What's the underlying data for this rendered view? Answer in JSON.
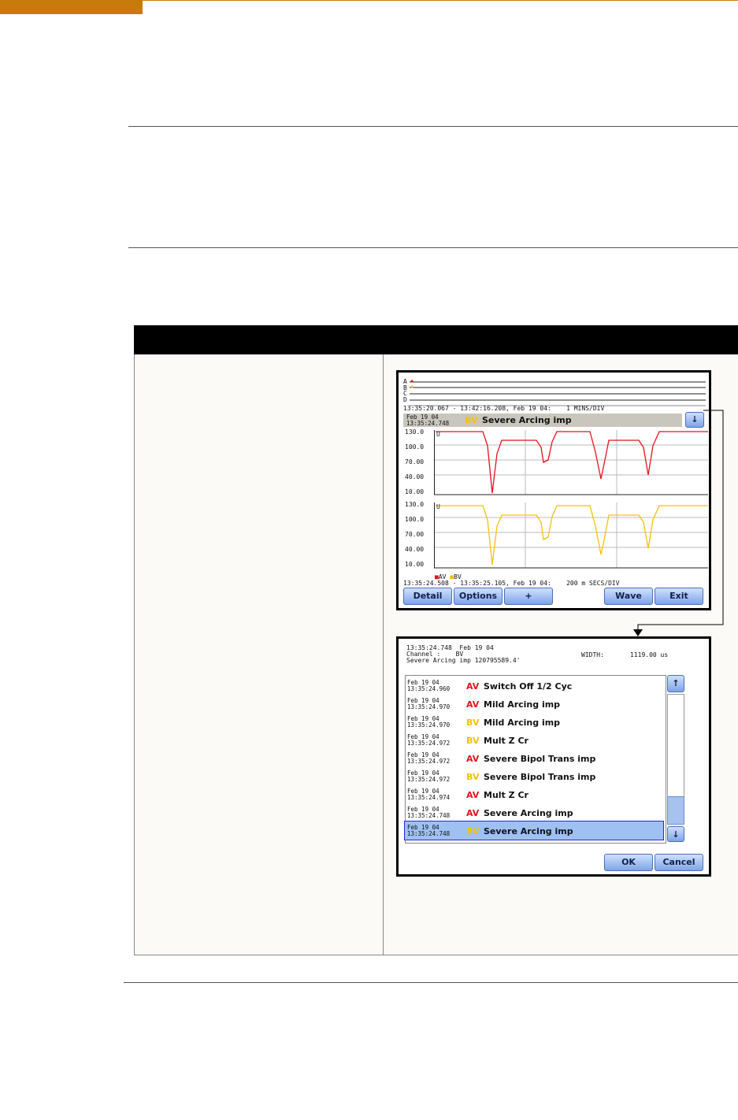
{
  "screen1": {
    "channels": [
      "A",
      "B",
      "C",
      "D"
    ],
    "overview_range": "13:35:20.067 - 13:42:16.208, Feb 19 04:    1 MINS/DIV",
    "event_date": "Feb 19 04",
    "event_time": "13:35:24.748",
    "event_channel": "BV",
    "event_name": "Severe Arcing imp",
    "yticks": [
      "130.0",
      "100.0",
      "70.00",
      "40.00",
      "10.00"
    ],
    "unit_label": "U",
    "legend": [
      {
        "name": "AV",
        "color": "#e8101a"
      },
      {
        "name": "BV",
        "color": "#f5c10a"
      }
    ],
    "detail_range": "13:35:24.508 - 13:35:25.105, Feb 19 04:    200 m SECS/DIV",
    "buttons": {
      "detail": "Detail",
      "options": "Options",
      "plus": "+",
      "wave": "Wave",
      "exit": "Exit"
    }
  },
  "screen2": {
    "header_line1": "13:35:24.748  Feb 19 04",
    "header_line2": "Channel :    BV",
    "header_line3": "Severe Arcing imp 120795589.4'",
    "width_label": "WIDTH:",
    "width_value": "1119.00 us",
    "events": [
      {
        "date": "Feb 19 04",
        "time": "13:35:24.960",
        "channel": "AV",
        "name": "Switch Off 1/2 Cyc"
      },
      {
        "date": "Feb 19 04",
        "time": "13:35:24.970",
        "channel": "AV",
        "name": "Mild Arcing imp"
      },
      {
        "date": "Feb 19 04",
        "time": "13:35:24.970",
        "channel": "BV",
        "name": "Mild Arcing imp"
      },
      {
        "date": "Feb 19 04",
        "time": "13:35:24.972",
        "channel": "BV",
        "name": "Mult Z Cr"
      },
      {
        "date": "Feb 19 04",
        "time": "13:35:24.972",
        "channel": "AV",
        "name": "Severe Bipol Trans imp"
      },
      {
        "date": "Feb 19 04",
        "time": "13:35:24.972",
        "channel": "BV",
        "name": "Severe Bipol Trans imp"
      },
      {
        "date": "Feb 19 04",
        "time": "13:35:24.974",
        "channel": "AV",
        "name": "Mult Z Cr"
      },
      {
        "date": "Feb 19 04",
        "time": "13:35:24.748",
        "channel": "AV",
        "name": "Severe Arcing imp"
      },
      {
        "date": "Feb 19 04",
        "time": "13:35:24.748",
        "channel": "BV",
        "name": "Severe Arcing imp",
        "selected": true
      }
    ],
    "ok": "OK",
    "cancel": "Cancel"
  },
  "colors": {
    "accent": "#c87a0a",
    "av": "#e8101a",
    "bv": "#f5c10a",
    "button": "#7fa4e6"
  }
}
